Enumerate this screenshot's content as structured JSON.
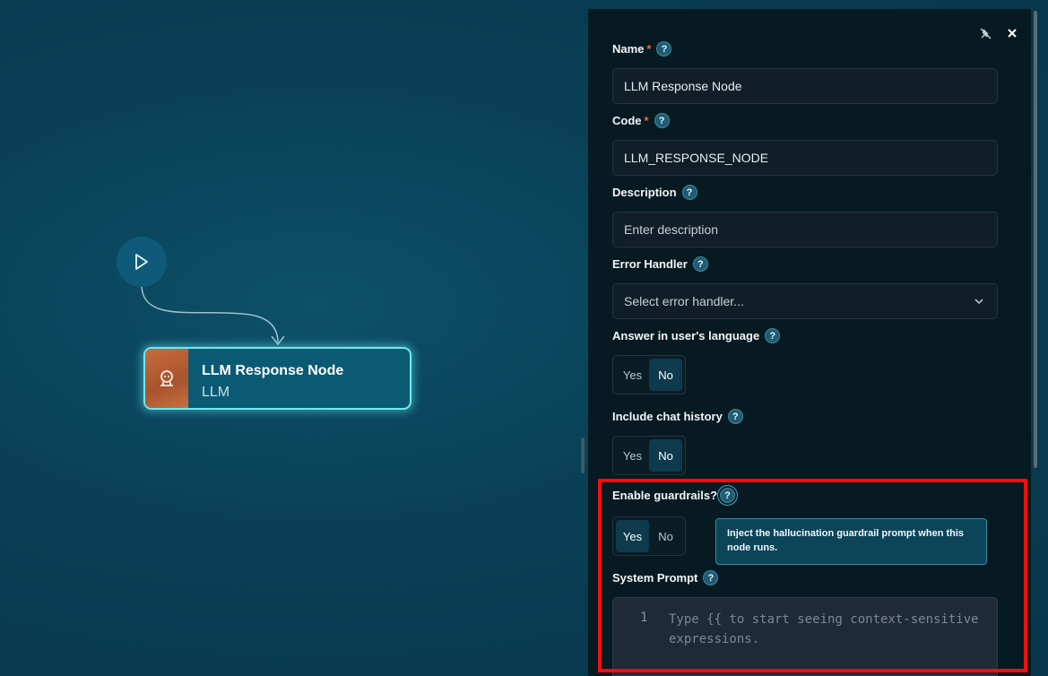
{
  "canvas": {
    "node": {
      "title": "LLM Response Node",
      "type": "LLM"
    }
  },
  "panel": {
    "fields": {
      "name": {
        "label": "Name",
        "required": "*",
        "value": "LLM Response Node"
      },
      "code": {
        "label": "Code",
        "required": "*",
        "value": "LLM_RESPONSE_NODE"
      },
      "description": {
        "label": "Description",
        "placeholder": "Enter description"
      },
      "error_handler": {
        "label": "Error Handler",
        "placeholder": "Select error handler..."
      },
      "answer_language": {
        "label": "Answer in user's language",
        "yes": "Yes",
        "no": "No",
        "selected": "No"
      },
      "chat_history": {
        "label": "Include chat history",
        "yes": "Yes",
        "no": "No",
        "selected": "No"
      },
      "guardrails": {
        "label": "Enable guardrails?",
        "yes": "Yes",
        "no": "No",
        "selected": "Yes"
      },
      "system_prompt": {
        "label": "System Prompt",
        "line_number": "1",
        "placeholder": "Type {{ to start seeing context-sensitive expressions."
      }
    },
    "help_glyph": "?",
    "tooltip": "Inject the hallucination guardrail prompt when this node runs."
  },
  "colors": {
    "highlight": "#ff0b0b",
    "accent": "#6fe8f0",
    "required": "#e8663d"
  },
  "icons": [
    "play-icon",
    "robot-icon",
    "unpin-icon",
    "close-icon",
    "chevron-down-icon",
    "help-icon"
  ]
}
